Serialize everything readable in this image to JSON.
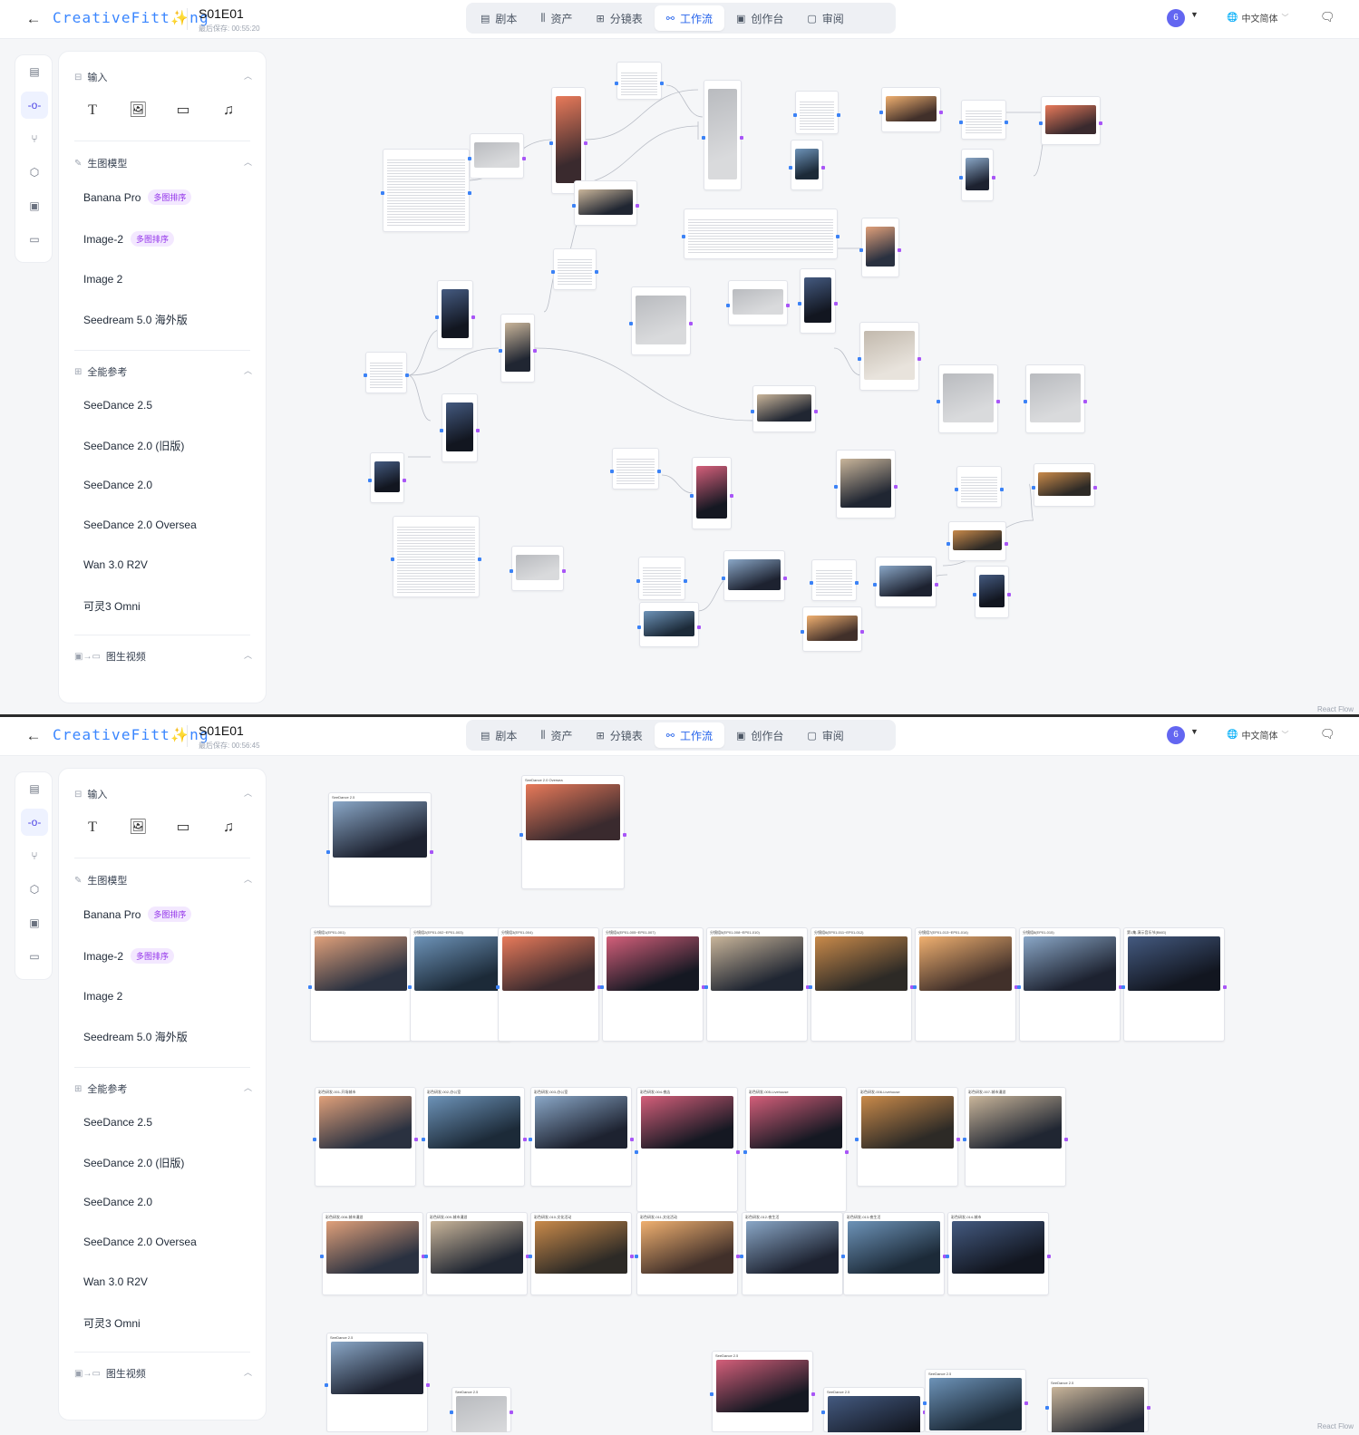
{
  "app": {
    "logo": "CreativeFitt✨ng",
    "back_icon": "arrow-left-icon",
    "nav_tabs": [
      {
        "label": "剧本",
        "icon": "document-icon"
      },
      {
        "label": "资产",
        "icon": "library-icon"
      },
      {
        "label": "分镜表",
        "icon": "table-icon"
      },
      {
        "label": "工作流",
        "icon": "workflow-icon"
      },
      {
        "label": "创作台",
        "icon": "studio-icon"
      },
      {
        "label": "审阅",
        "icon": "review-icon"
      }
    ],
    "active_tab": "工作流",
    "avatar_label": "6",
    "language": "中文简体",
    "accent_color": "#2563eb",
    "badge_color": "#9333ea"
  },
  "panels": [
    {
      "episode_title": "S01E01",
      "saved_text": "最后保存: 00:55:20"
    },
    {
      "episode_title": "S01E01",
      "saved_text": "最后保存: 00:56:45"
    }
  ],
  "library": {
    "input": {
      "title": "输入",
      "tools": [
        "text-icon",
        "image-icon",
        "video-icon",
        "audio-icon"
      ]
    },
    "image_models": {
      "title": "生图模型",
      "items": [
        {
          "label": "Banana Pro",
          "badge": "多图排序"
        },
        {
          "label": "Image-2",
          "badge": "多图排序"
        },
        {
          "label": "Image 2",
          "badge": ""
        },
        {
          "label": "Seedream 5.0 海外版",
          "badge": ""
        }
      ]
    },
    "all_reference": {
      "title": "全能参考",
      "items": [
        "SeeDance 2.5",
        "SeeDance 2.0 (旧版)",
        "SeeDance 2.0",
        "SeeDance 2.0 Oversea",
        "Wan 3.0 R2V",
        "可灵3 Omni"
      ]
    },
    "img2video": {
      "title": "图生视频"
    }
  },
  "canvas": {
    "watermark": "React Flow",
    "panel2_nodes": {
      "top": [
        "SeeDance 2.5",
        "SeeDance 2.0 Oversea"
      ],
      "row1": [
        "分镜组1(EP01-001)",
        "分镜组2(EP01-002~EP01-003)",
        "分镜组3(EP01-004)",
        "分镜组4(EP01-005~EP01-007)",
        "分镜组5(EP01-008~EP01-010)",
        "分镜组6(EP01-011~EP01-012)",
        "分镜组7(EP01-013~EP01-014)",
        "分镜组8(EP01-015)",
        "第1集-演示音乐节(BMG)"
      ],
      "row2": [
        "彩色研发-001-开场城市",
        "彩色研发-002-办公室",
        "彩色研发-003-办公室",
        "彩色研发-004-夜店",
        "彩色研发-005-Livehouse",
        "彩色研发-006-Livehouse",
        "彩色研发-007-城市漫游"
      ],
      "row3": [
        "彩色研发-008-城市漫游",
        "彩色研发-009-城市漫游",
        "彩色研发-010-文化活动",
        "彩色研发-011-文化活动",
        "彩色研发-012-夜生活",
        "彩色研发-013-夜生活",
        "彩色研发-014-城市"
      ],
      "bottom": [
        "SeeDance 2.5",
        "SeeDance 2.5",
        "SeeDance 2.5",
        "SeeDance 2.5",
        "SeeDance 2.5",
        "SeeDance 2.5"
      ]
    }
  }
}
